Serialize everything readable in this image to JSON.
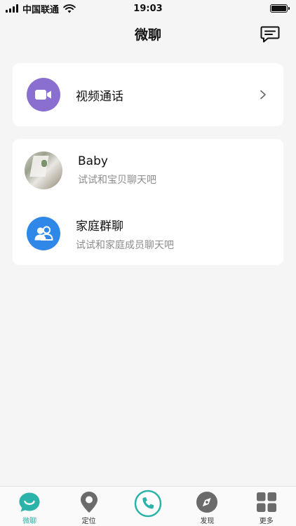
{
  "status_bar": {
    "carrier": "中国联通",
    "time": "19:03"
  },
  "header": {
    "title": "微聊",
    "action_icon": "message-icon"
  },
  "video_call": {
    "title": "视频通话",
    "icon": "video-camera-icon",
    "icon_color": "#8a6fd0"
  },
  "chats": [
    {
      "title": "Baby",
      "subtitle": "试试和宝贝聊天吧",
      "icon": "avatar"
    },
    {
      "title": "家庭群聊",
      "subtitle": "试试和家庭成员聊天吧",
      "icon": "group-icon",
      "icon_color": "#2f88e8"
    }
  ],
  "tabs": [
    {
      "label": "微聊",
      "icon": "smile-chat-icon",
      "active": true
    },
    {
      "label": "定位",
      "icon": "location-pin-icon"
    },
    {
      "label": "",
      "icon": "phone-icon"
    },
    {
      "label": "发现",
      "icon": "compass-icon"
    },
    {
      "label": "更多",
      "icon": "grid-icon"
    }
  ],
  "colors": {
    "accent": "#27b3a8",
    "background": "#f5f5f5"
  }
}
